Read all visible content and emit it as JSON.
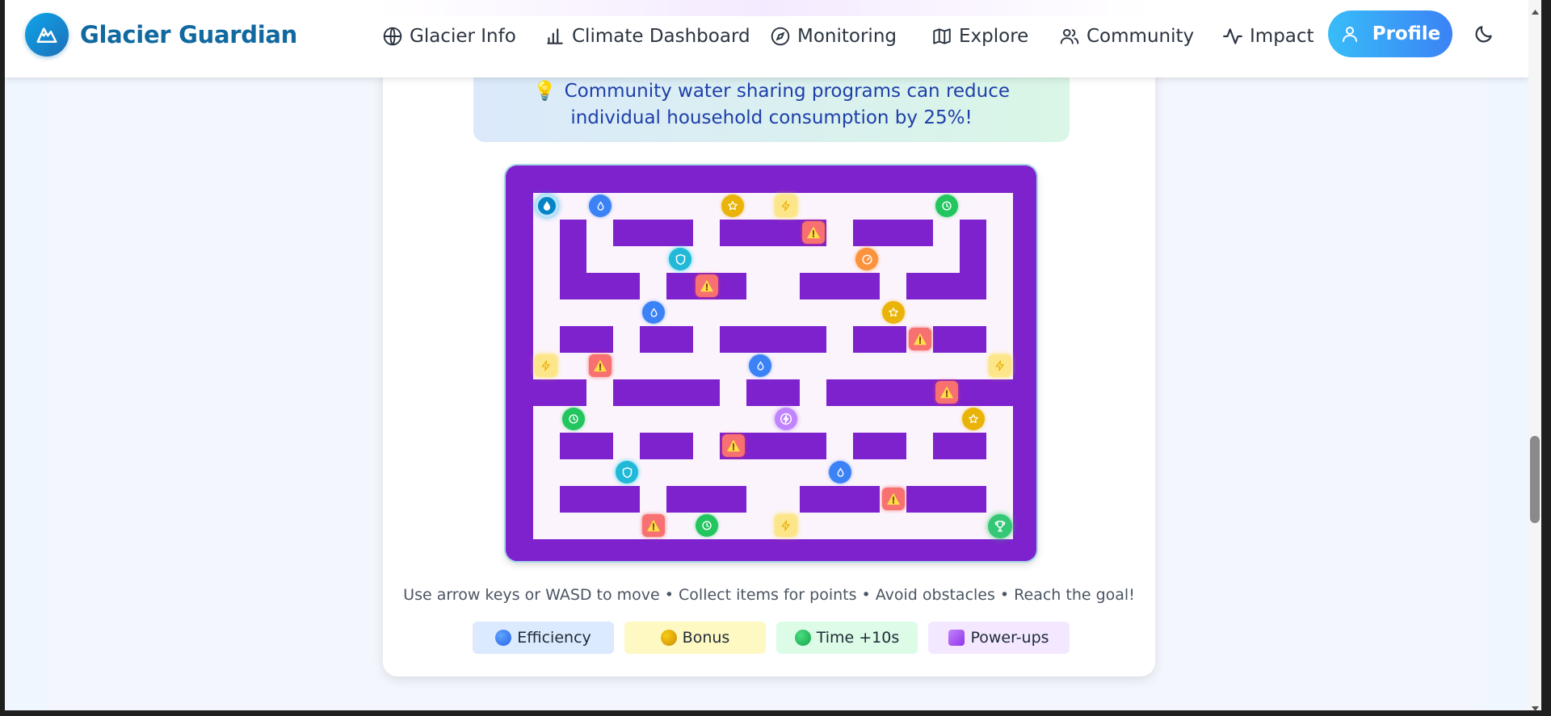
{
  "brand": {
    "name": "Glacier Guardian",
    "logo_icon": "mountain-icon"
  },
  "nav": {
    "items": [
      {
        "label": "Glacier Info",
        "icon": "globe-icon"
      },
      {
        "label": "Climate Dashboard",
        "icon": "bar-chart-icon"
      },
      {
        "label": "Monitoring",
        "icon": "compass-icon"
      },
      {
        "label": "Explore",
        "icon": "map-icon"
      },
      {
        "label": "Community",
        "icon": "users-icon"
      },
      {
        "label": "Impact",
        "icon": "activity-icon"
      }
    ],
    "profile_label": "Profile",
    "theme_icon": "moon-icon"
  },
  "tip": {
    "icon": "lightbulb-icon",
    "text": "Community water sharing programs can reduce individual household consumption by 25%!"
  },
  "game": {
    "instructions": "Use arrow keys or WASD to move • Collect items for points • Avoid obstacles • Reach the goal!",
    "legend": [
      {
        "label": "Efficiency",
        "color": "#3b82f6",
        "bg": "#dbeafe"
      },
      {
        "label": "Bonus",
        "color": "#eab308",
        "bg": "#fef9c3"
      },
      {
        "label": "Time +10s",
        "color": "#22c55e",
        "bg": "#dcfce7"
      },
      {
        "label": "Power-ups",
        "color": "#a855f7",
        "bg": "#f3e8ff"
      }
    ],
    "colors": {
      "wall": "#7e22ce",
      "floor": "#fcf4fc"
    }
  }
}
